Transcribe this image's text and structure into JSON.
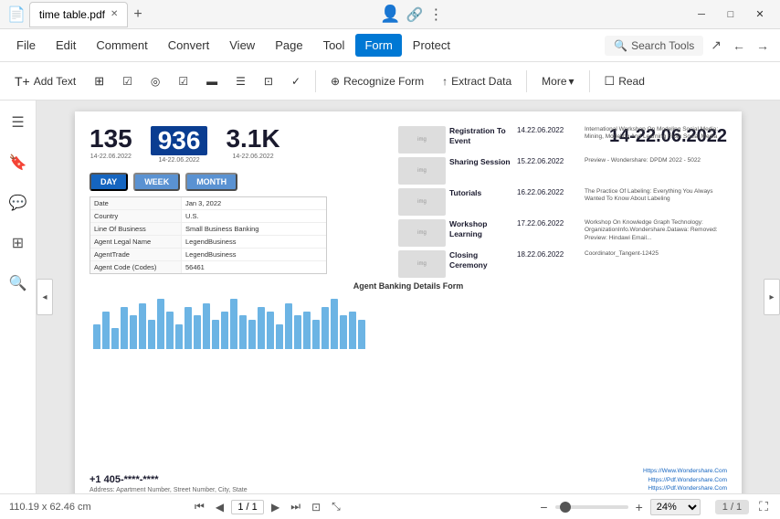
{
  "titleBar": {
    "filename": "time table.pdf",
    "newTab": "+",
    "appIcon": "📄",
    "controls": {
      "minimize": "─",
      "maximize": "□",
      "close": "✕"
    },
    "icons": {
      "profile": "👤",
      "bookmark": "🔖",
      "more": "⋮"
    }
  },
  "menuBar": {
    "items": [
      "File",
      "Edit",
      "Comment",
      "Convert",
      "View",
      "Page",
      "Tool",
      "Form",
      "Protect"
    ]
  },
  "toolbar": {
    "addText": "Add Text",
    "recognize": "Recognize Form",
    "extractData": "Extract Data",
    "more": "More",
    "read": "Read",
    "tools": [
      "T",
      "⊞",
      "☑",
      "◎",
      "☑",
      "▬",
      "⊡",
      "⊞",
      "✓"
    ]
  },
  "document": {
    "stats": {
      "values": [
        "135",
        "936",
        "3.1K"
      ],
      "dates": [
        "14-22.06.2022",
        "14-22.06.2022",
        "14-22.06.2022"
      ],
      "bigDate": "14-22.06.2022"
    },
    "periods": [
      "DAY",
      "WEEK",
      "MONTH"
    ],
    "formTitle": "Agent Banking Details Form",
    "formRows": [
      {
        "label": "Date",
        "value": "Jan 3, 2022"
      },
      {
        "label": "Country",
        "value": "U.S."
      },
      {
        "label": "Line Of Business",
        "value": "Small Business Banking"
      },
      {
        "label": "Agent Legal Name",
        "value": "LegendBusiness"
      },
      {
        "label": "AgentTrade",
        "value": "LegendBusiness"
      },
      {
        "label": "Agent Code (Codes)",
        "value": "56461"
      }
    ],
    "schedule": [
      {
        "event": "Registration To Event",
        "date": "14.22.06.2022",
        "desc": "International Workshop On Modeling Social Media: Mining, Modeling And Learning From Social Media"
      },
      {
        "event": "Sharing Session",
        "date": "15.22.06.2022",
        "desc": "Preview - Wondershare: DPDM 2022 - 5022"
      },
      {
        "event": "Tutorials",
        "date": "16.22.06.2022",
        "desc": "The Practice Of Labeling: Everything You Always Wanted To Know About Labeling"
      },
      {
        "event": "Workshop Learning",
        "date": "17.22.06.2022",
        "desc": "Workshop On Knowledge Graph Technology: OrganizationInfo.Wondershare.Datawa: Removed: Preview: Hindawi Email..."
      },
      {
        "event": "Closing Ceremony",
        "date": "18.22.06.2022",
        "desc": "Coordinator_Tangent-12425"
      }
    ],
    "phone": "+1 405-****-****",
    "address": "Address: Apartment Number, Street Number, City, State",
    "websites": [
      "Https://Www.Wondershare.Com",
      "Https://Pdf.Wondershare.Com",
      "Https://Pdf.Wondershare.Com"
    ]
  },
  "bottomBar": {
    "dimensions": "110.19 x 62.46 cm",
    "page": "1 / 1",
    "zoom": "24%",
    "pageInfo": "1 / 1"
  },
  "sidebar": {
    "icons": [
      "☰",
      "🔖",
      "💬",
      "⊞",
      "🔍"
    ]
  },
  "chart": {
    "bars": [
      30,
      45,
      25,
      50,
      40,
      55,
      35,
      60,
      45,
      30,
      50,
      40,
      55,
      35,
      45,
      60,
      40,
      35,
      50,
      45,
      30,
      55,
      40,
      45,
      35,
      50,
      60,
      40,
      45,
      35
    ]
  }
}
